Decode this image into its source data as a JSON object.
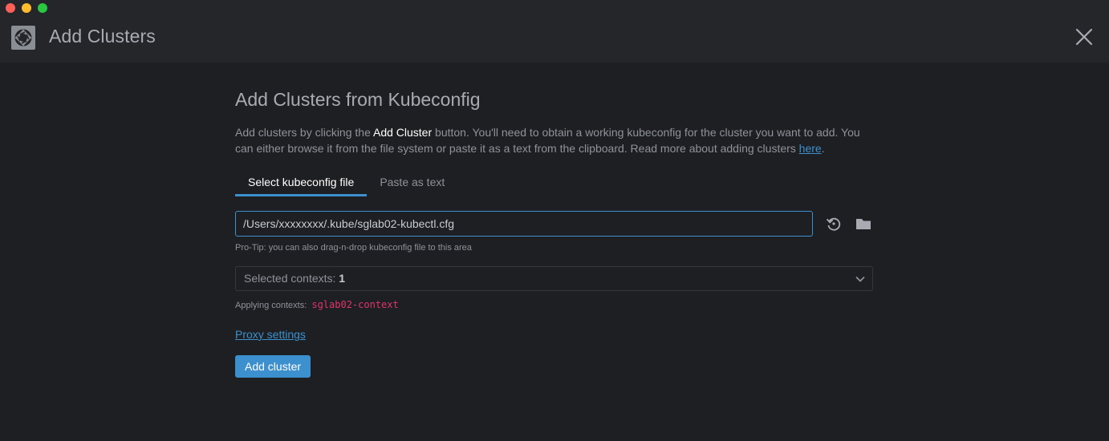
{
  "window": {
    "title": "Add Clusters"
  },
  "page": {
    "heading": "Add Clusters from Kubeconfig",
    "description": {
      "part1": "Add clusters by clicking the ",
      "strong": "Add Cluster",
      "part2": " button. You'll need to obtain a working kubeconfig for the cluster you want to add. You can either browse it from the file system or paste it as a text from the clipboard. Read more about adding clusters ",
      "link": "here",
      "part3": "."
    }
  },
  "tabs": [
    {
      "label": "Select kubeconfig file",
      "active": true
    },
    {
      "label": "Paste as text",
      "active": false
    }
  ],
  "file_picker": {
    "value": "/Users/xxxxxxxx/.kube/sglab02-kubectl.cfg",
    "protip": "Pro-Tip: you can also drag-n-drop kubeconfig file to this area"
  },
  "contexts": {
    "label": "Selected contexts: ",
    "count": "1",
    "applying_label": "Applying contexts:",
    "applying_value": "sglab02-context"
  },
  "proxy_link": "Proxy settings",
  "add_button": "Add cluster",
  "icons": {
    "app": "lens-aperture-icon",
    "close": "close-icon",
    "reload": "reload-icon",
    "folder": "folder-icon",
    "chevron": "chevron-down-icon"
  },
  "colors": {
    "accent": "#3d90ce",
    "background": "#1e1f22",
    "header": "#252629",
    "context_code": "#e0346b"
  }
}
